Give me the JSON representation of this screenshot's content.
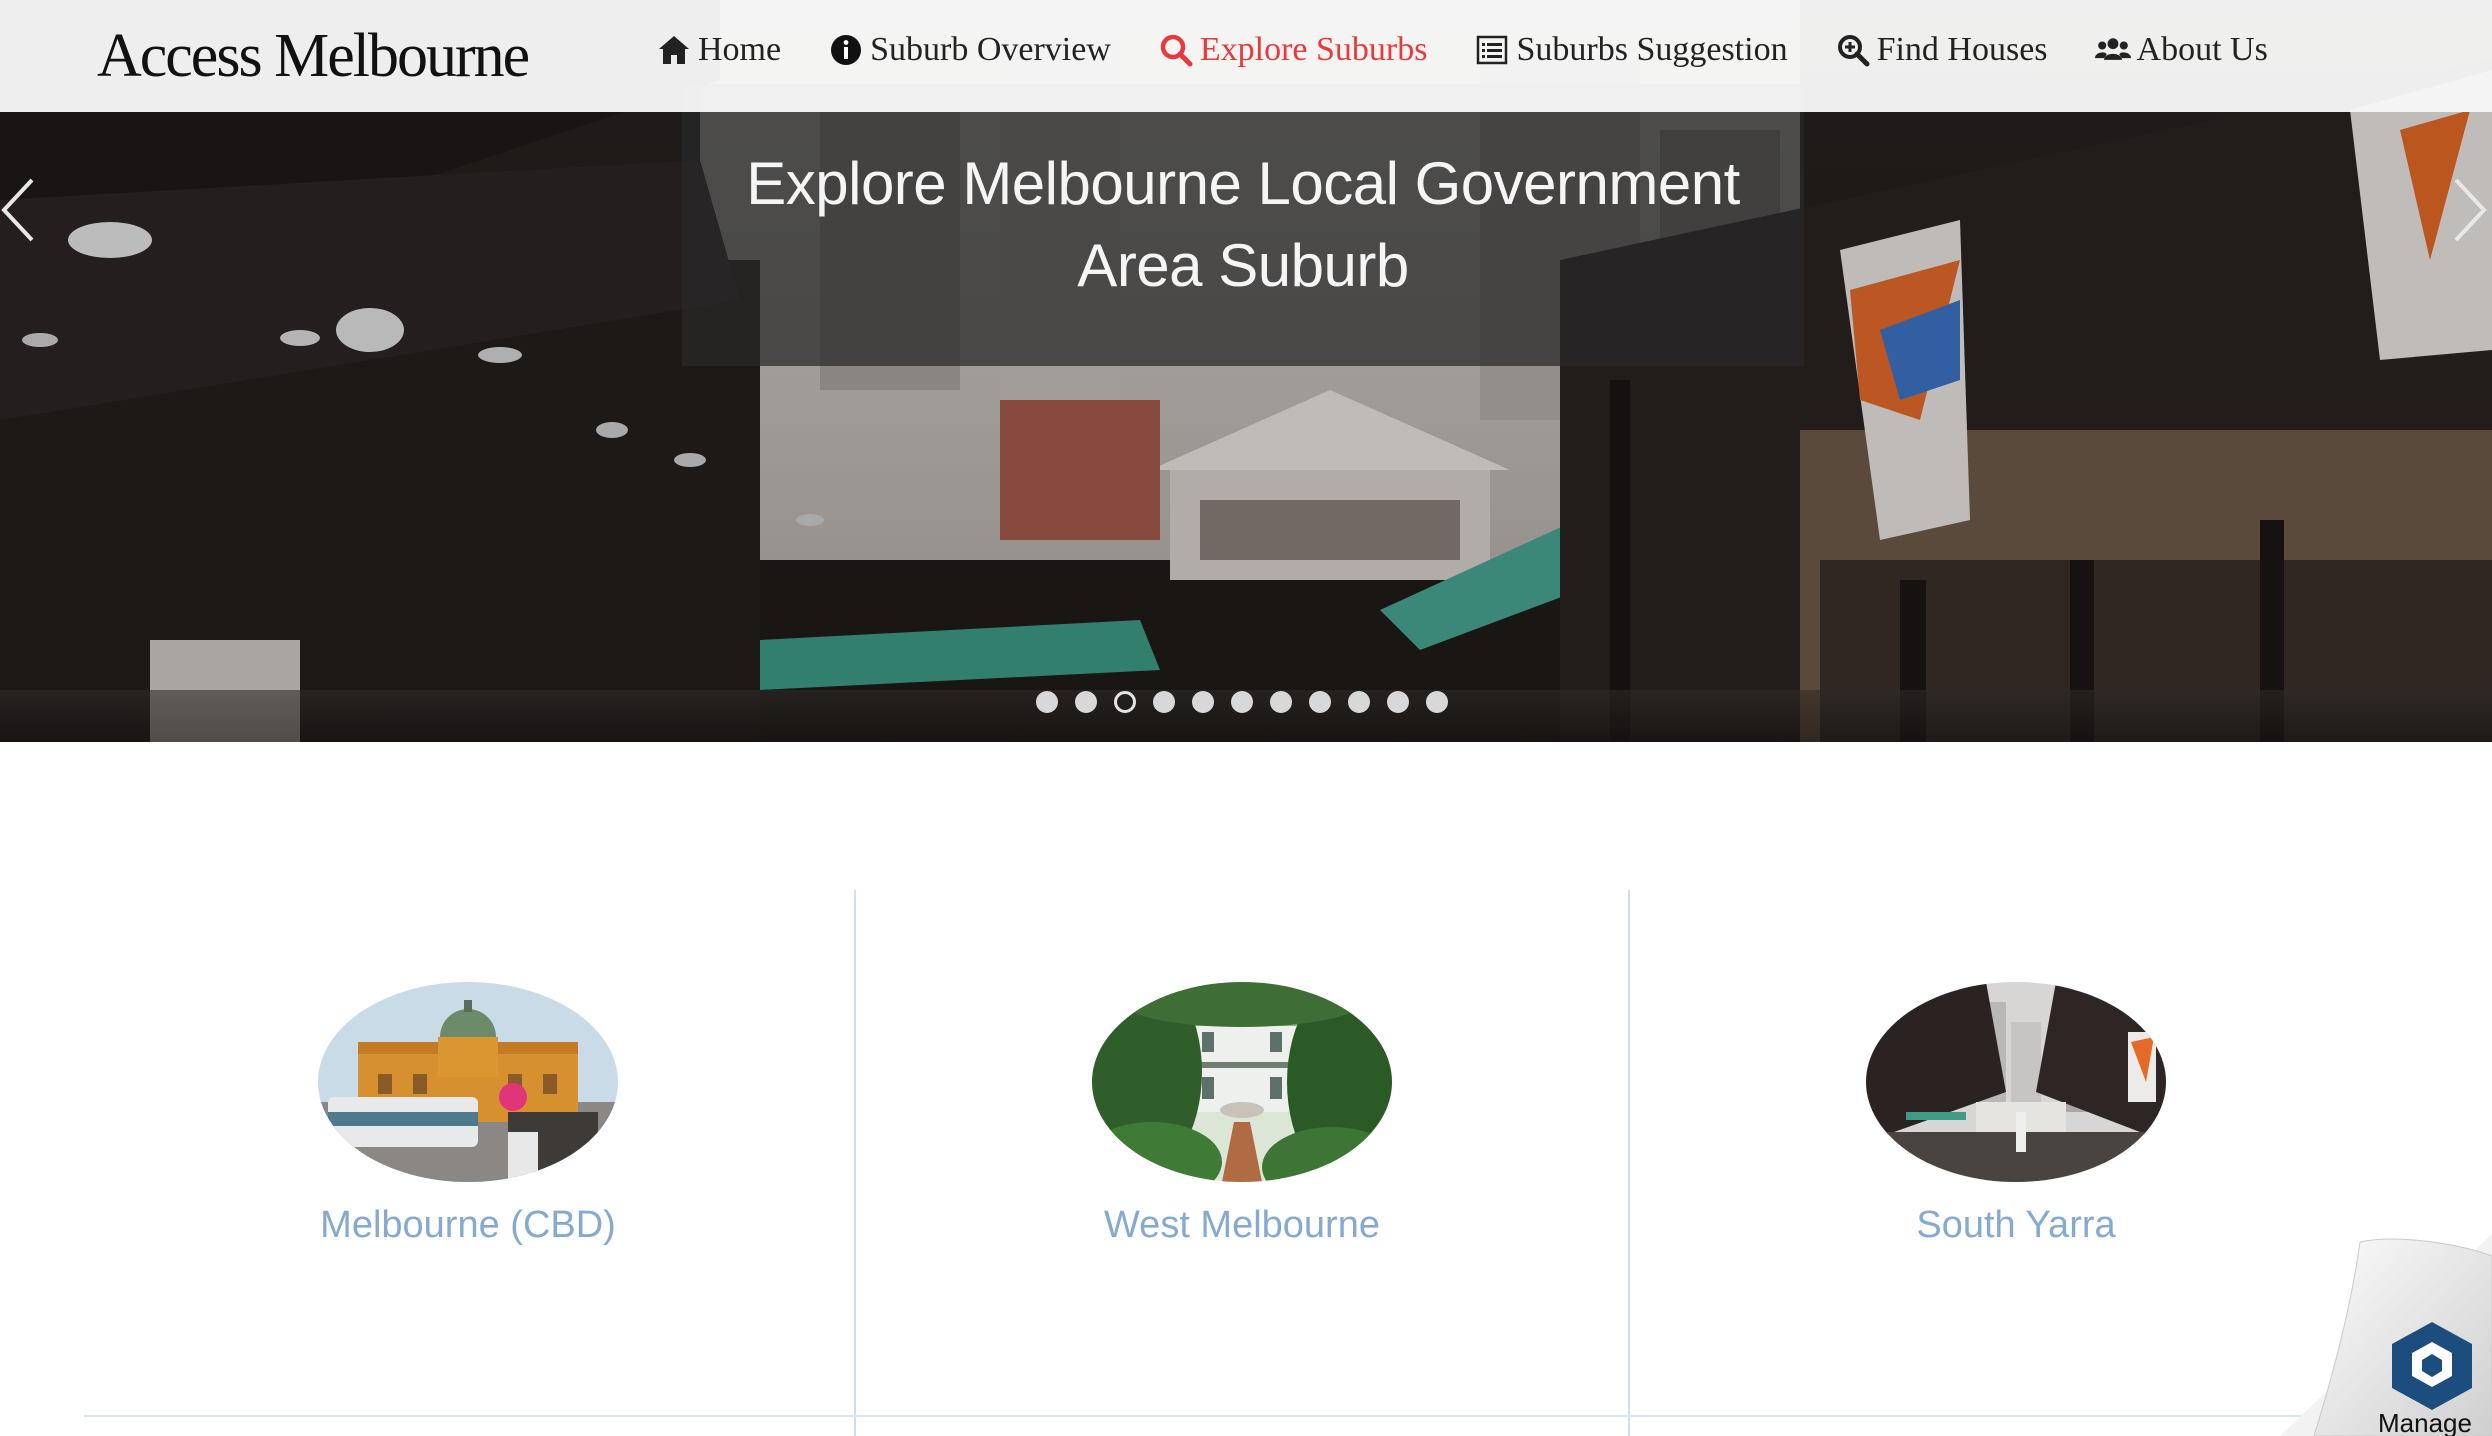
{
  "brand": "Access Melbourne",
  "nav": {
    "items": [
      {
        "label": "Home",
        "icon": "home-icon"
      },
      {
        "label": "Suburb Overview",
        "icon": "info-circle-icon"
      },
      {
        "label": "Explore Suburbs",
        "icon": "search-icon",
        "active": true
      },
      {
        "label": "Suburbs Suggestion",
        "icon": "list-alt-icon"
      },
      {
        "label": "Find Houses",
        "icon": "search-plus-icon"
      },
      {
        "label": "About Us",
        "icon": "users-icon"
      }
    ],
    "active_color": "#e8393c"
  },
  "hero": {
    "caption": "Explore Melbourne Local Government Area Suburb",
    "slide_count": 11,
    "active_slide": 3
  },
  "suburbs": [
    {
      "name": "Melbourne (CBD)"
    },
    {
      "name": "West Melbourne"
    },
    {
      "name": "South Yarra"
    }
  ],
  "link_color": "#86a9cf",
  "manage_badge": {
    "label": "Manage",
    "icon": "hexagon-logo-icon"
  }
}
